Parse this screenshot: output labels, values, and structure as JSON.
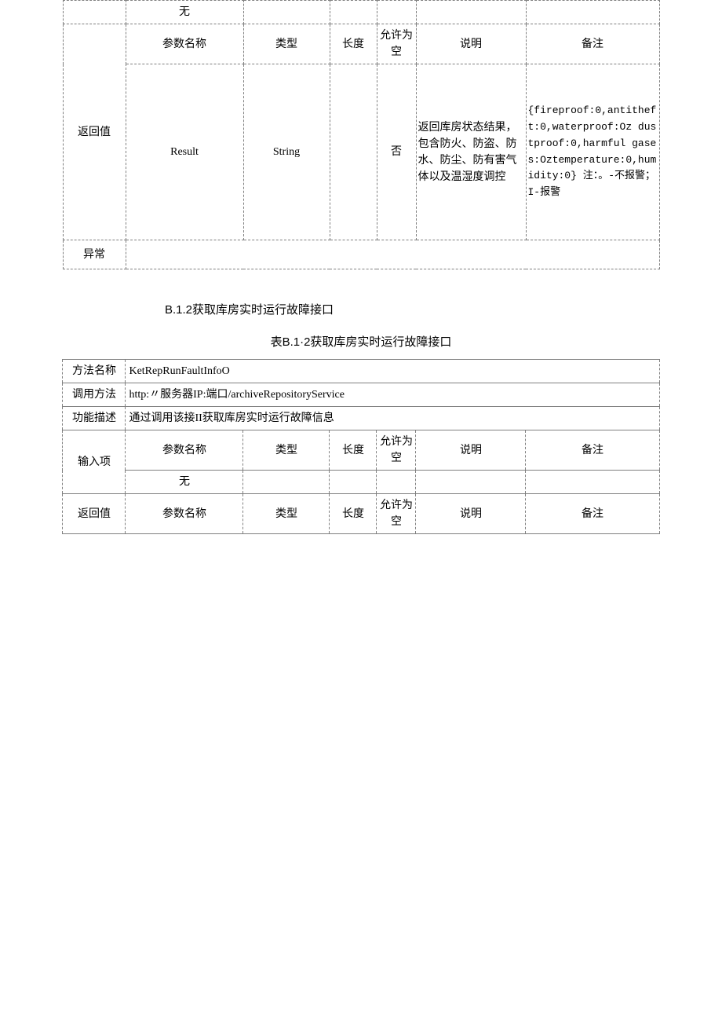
{
  "table1": {
    "row_none": "无",
    "header": {
      "param_name": "参数名称",
      "type": "类型",
      "length": "长度",
      "nullable": "允许为空",
      "desc": "说明",
      "remark": "备注"
    },
    "return_label": "返回值",
    "return_row": {
      "name": "Result",
      "type": "String",
      "length": "",
      "nullable": "否",
      "desc": "返回库房状态结果，包含防火、防盗、防水、防尘、防有害气体以及温湿度调控",
      "remark": "{fireproof:0,antitheft:0,waterproof:Oz dustproof:0,harmful gases:Oztemperature:0,humidity:0}\n注：。-不报警；I-报警"
    },
    "exception_label": "异常"
  },
  "section": {
    "heading": "B.1.2获取库房实时运行故障接口",
    "caption": "表B.1·2获取库房实时运行故障接口"
  },
  "table2": {
    "method_name_label": "方法名称",
    "method_name_value": "KetRepRunFaultInfoO",
    "call_label": "调用方法",
    "call_value": "http:〃服务器IP:端口/archiveRepositoryService",
    "func_label": "功能描述",
    "func_value": "通过调用该接II获取库房实时运行故障信息",
    "input_label": "输入项",
    "header": {
      "param_name": "参数名称",
      "type": "类型",
      "length": "长度",
      "nullable": "允许为空",
      "desc": "说明",
      "remark": "备注"
    },
    "row_none": "无",
    "return_label": "返回值"
  }
}
